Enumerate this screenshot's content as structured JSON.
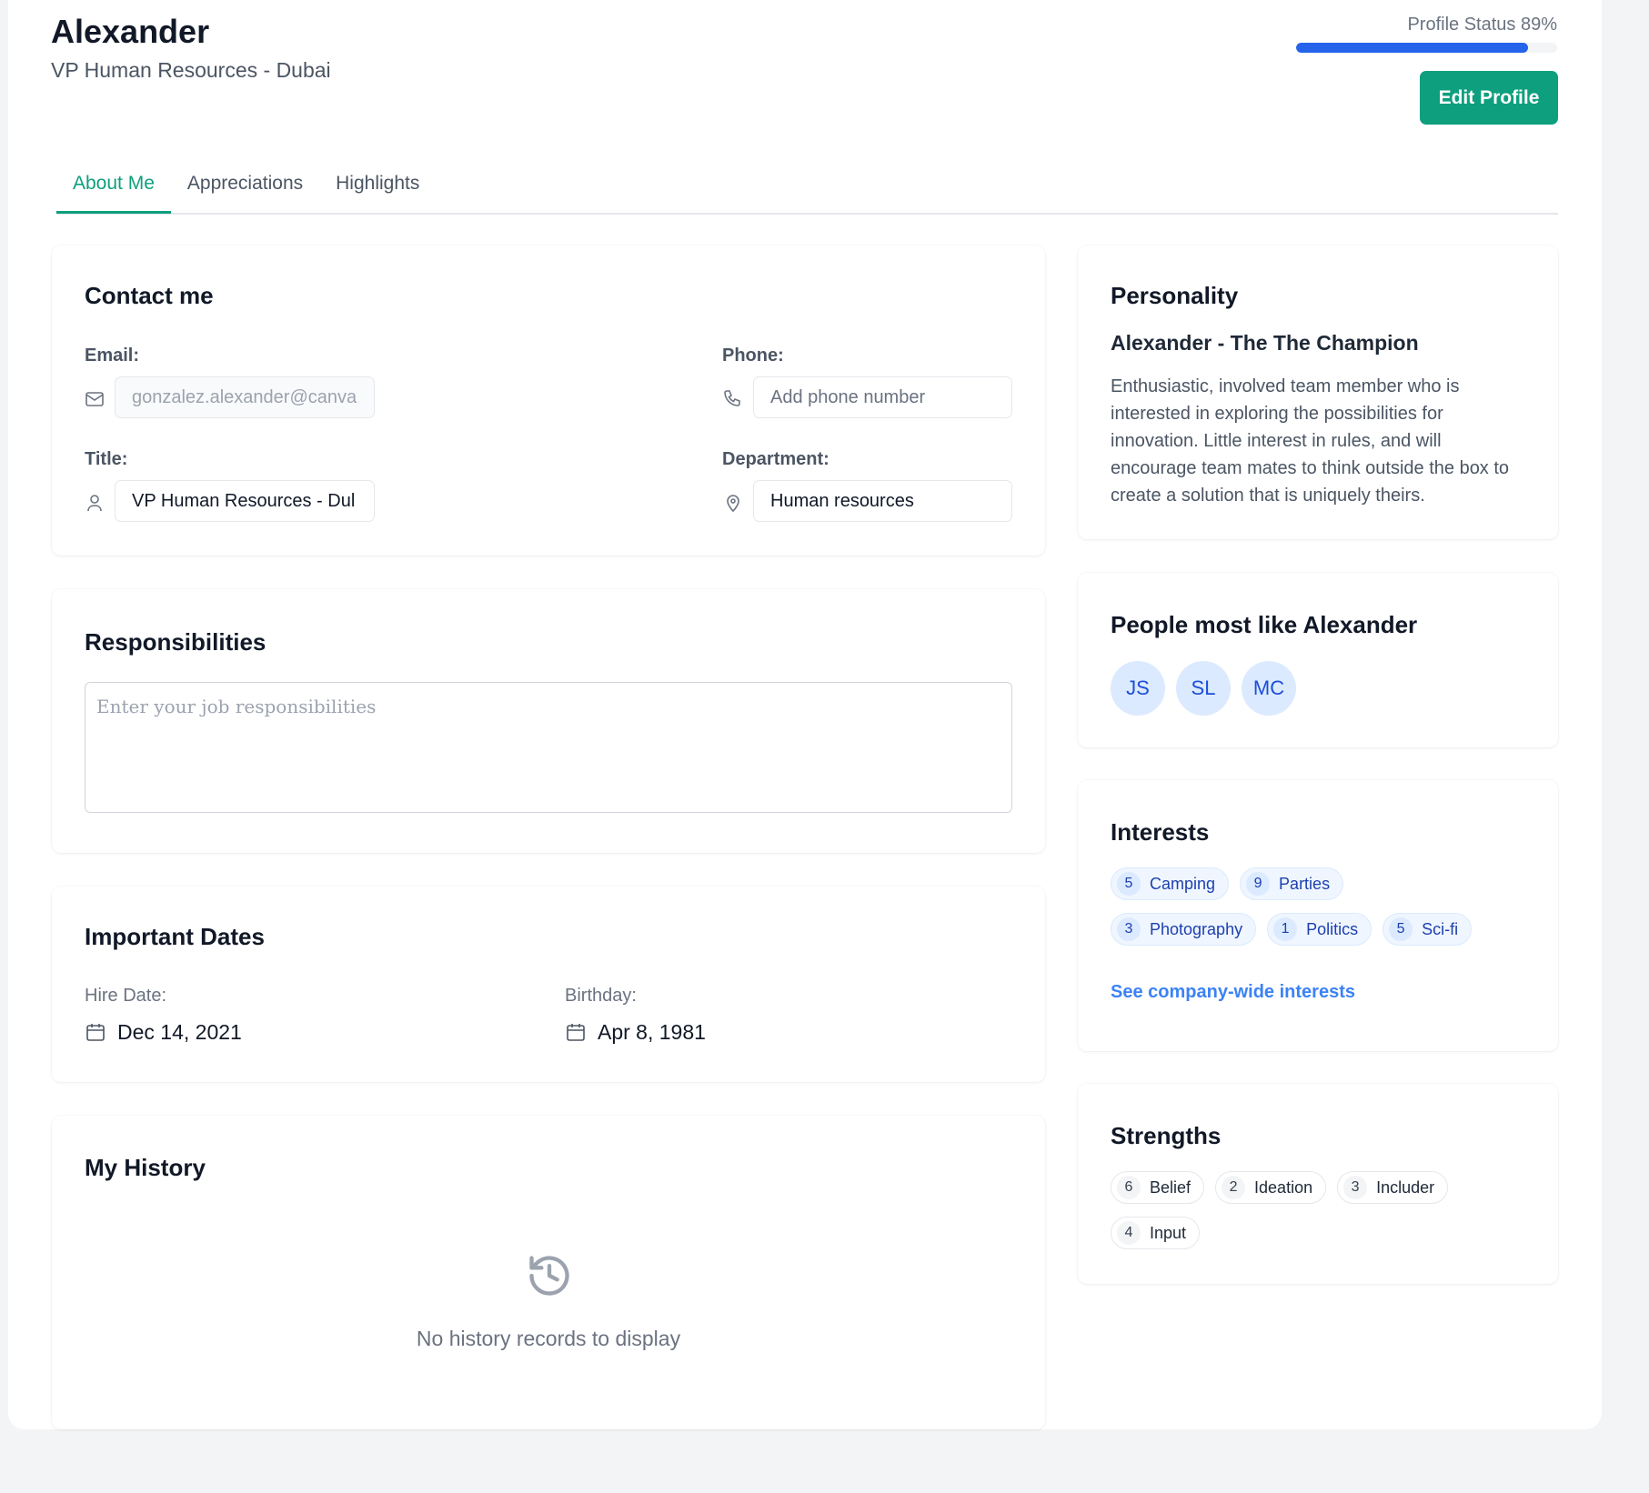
{
  "header": {
    "name": "Alexander",
    "subtitle": "VP Human Resources - Dubai",
    "profile_status_label": "Profile Status 89%",
    "profile_status_value": 0.89,
    "edit_button": "Edit Profile"
  },
  "tabs": [
    {
      "label": "About Me",
      "active": true
    },
    {
      "label": "Appreciations",
      "active": false
    },
    {
      "label": "Highlights",
      "active": false
    }
  ],
  "contact": {
    "title": "Contact me",
    "email_label": "Email:",
    "email_value": "gonzalez.alexander@canva",
    "phone_label": "Phone:",
    "phone_placeholder": "Add phone number",
    "title_label": "Title:",
    "title_value": "VP Human Resources - Dul",
    "department_label": "Department:",
    "department_value": "Human resources"
  },
  "responsibilities": {
    "title": "Responsibilities",
    "placeholder": "Enter your job responsibilities"
  },
  "dates": {
    "title": "Important Dates",
    "hire_label": "Hire Date:",
    "hire_value": "Dec 14, 2021",
    "birthday_label": "Birthday:",
    "birthday_value": "Apr 8, 1981"
  },
  "history": {
    "title": "My History",
    "empty_text": "No history records to display"
  },
  "personality": {
    "title": "Personality",
    "type": "Alexander - The The Champion",
    "description": "Enthusiastic, involved team member who is interested in exploring the possibilities for innovation. Little interest in rules, and will encourage team mates to think outside the box to create a solution that is uniquely theirs."
  },
  "people": {
    "title": "People most like Alexander",
    "avatars": [
      "JS",
      "SL",
      "MC"
    ]
  },
  "interests": {
    "title": "Interests",
    "items": [
      {
        "count": "5",
        "label": "Camping"
      },
      {
        "count": "9",
        "label": "Parties"
      },
      {
        "count": "3",
        "label": "Photography"
      },
      {
        "count": "1",
        "label": "Politics"
      },
      {
        "count": "5",
        "label": "Sci-fi"
      }
    ],
    "link": "See company-wide interests"
  },
  "strengths": {
    "title": "Strengths",
    "items": [
      {
        "count": "6",
        "label": "Belief"
      },
      {
        "count": "2",
        "label": "Ideation"
      },
      {
        "count": "3",
        "label": "Includer"
      },
      {
        "count": "4",
        "label": "Input"
      }
    ]
  },
  "colors": {
    "accent": "#0e9f7e",
    "progress": "#2563eb",
    "chip": "#dbeafe",
    "link": "#3b82f6"
  }
}
